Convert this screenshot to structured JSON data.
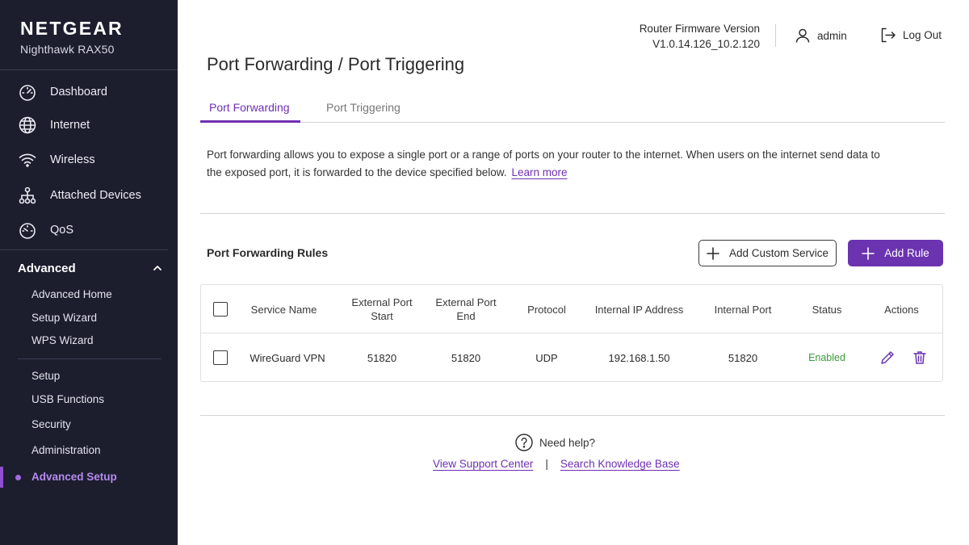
{
  "brand": {
    "logo": "NETGEAR",
    "model": "Nighthawk RAX50"
  },
  "sidebar": {
    "nav": [
      {
        "label": "Dashboard",
        "icon": "gauge-icon"
      },
      {
        "label": "Internet",
        "icon": "globe-icon"
      },
      {
        "label": "Wireless",
        "icon": "wifi-icon"
      },
      {
        "label": "Attached Devices",
        "icon": "network-icon"
      },
      {
        "label": "QoS",
        "icon": "gauge-icon"
      }
    ],
    "section": {
      "label": "Advanced",
      "icon": "chevron-up-icon",
      "expanded": true
    },
    "group1": [
      "Advanced Home",
      "Setup Wizard",
      "WPS Wizard"
    ],
    "group2": [
      "Setup",
      "USB Functions",
      "Security",
      "Administration",
      "Advanced Setup"
    ],
    "active_item": "Advanced Setup"
  },
  "header": {
    "firmware_label": "Router Firmware Version",
    "firmware_version": "V1.0.14.126_10.2.120",
    "user": "admin",
    "logout": "Log Out"
  },
  "page": {
    "title": "Port Forwarding / Port Triggering",
    "tabs": [
      {
        "label": "Port Forwarding",
        "active": true
      },
      {
        "label": "Port Triggering",
        "active": false
      }
    ],
    "description": "Port forwarding allows you to expose a single port or a range of ports on your router to the internet. When users on the internet send data to the exposed port, it is forwarded to the device specified below.",
    "learn_more": "Learn more"
  },
  "rules": {
    "title": "Port Forwarding Rules",
    "add_custom_service": "Add Custom Service",
    "add_rule": "Add Rule",
    "columns": {
      "service_name": "Service Name",
      "ext_start": "External Port Start",
      "ext_end": "External Port End",
      "protocol": "Protocol",
      "internal_ip": "Internal IP Address",
      "internal_port": "Internal Port",
      "status": "Status",
      "actions": "Actions"
    },
    "rows": [
      {
        "service_name": "WireGuard VPN",
        "ext_start": "51820",
        "ext_end": "51820",
        "protocol": "UDP",
        "internal_ip": "192.168.1.50",
        "internal_port": "51820",
        "status": "Enabled"
      }
    ]
  },
  "help": {
    "label": "Need help?",
    "support_link": "View Support Center",
    "separator": "|",
    "kb_link": "Search Knowledge Base"
  },
  "colors": {
    "sidebar_bg": "#1c1e2e",
    "accent": "#6b33b0",
    "status_enabled": "#3b9a3b"
  }
}
